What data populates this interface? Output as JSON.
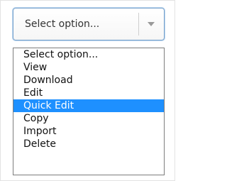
{
  "select": {
    "current_value": "Select option...",
    "caret_icon": "chevron-down-icon"
  },
  "options": [
    "Select option...",
    "View",
    "Download",
    "Edit",
    "Quick Edit",
    "Copy",
    "Import",
    "Delete"
  ],
  "highlighted_option": "Quick Edit",
  "colors": {
    "highlight_bg": "#1e90ff",
    "highlight_text": "#ffffff",
    "focus_border": "#7aa3cc"
  }
}
